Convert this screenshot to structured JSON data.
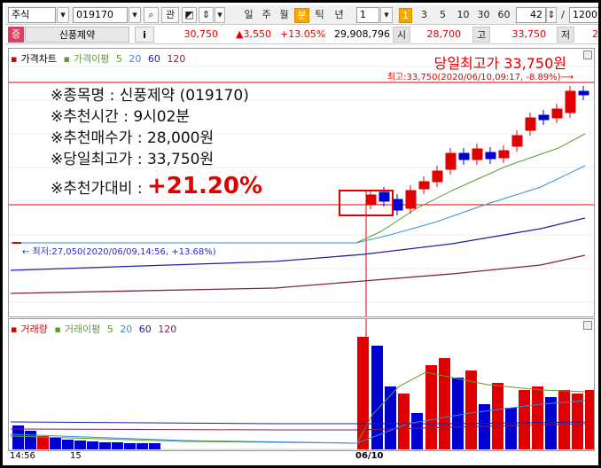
{
  "toolbar": {
    "market": "주식",
    "code": "019170",
    "btn_relation": "관",
    "periods": [
      {
        "label": "일",
        "active": false
      },
      {
        "label": "주",
        "active": false
      },
      {
        "label": "월",
        "active": false
      },
      {
        "label": "분",
        "active": true
      },
      {
        "label": "틱",
        "active": false
      },
      {
        "label": "년",
        "active": false
      }
    ],
    "interval_value": "1",
    "minute_buttons": [
      {
        "label": "1",
        "active": true
      },
      {
        "label": "3",
        "active": false
      },
      {
        "label": "5",
        "active": false
      },
      {
        "label": "10",
        "active": false
      },
      {
        "label": "30",
        "active": false
      },
      {
        "label": "60",
        "active": false
      }
    ],
    "count_value": "42",
    "count_total": "1200"
  },
  "quote": {
    "badge": "증",
    "name": "신풍제약",
    "info_btn": "i",
    "price": "30,750",
    "change": "▲3,550",
    "change_pct": "+13.05%",
    "volume": "29,908,796",
    "open_label": "시",
    "open": "28,700",
    "high_label": "고",
    "high": "33,750",
    "low_label": "저",
    "low_partial": "2"
  },
  "price_legend": {
    "title": "가격차트",
    "ma_label": "가격이평",
    "ma": [
      "5",
      "20",
      "60",
      "120"
    ]
  },
  "volume_legend": {
    "title": "거래량",
    "ma_label": "거래이평",
    "ma": [
      "5",
      "20",
      "60",
      "120"
    ]
  },
  "overlay": {
    "line1": "※종목명 : 신풍제약 (019170)",
    "line2": "※추천시간 : 9시02분",
    "line3": "※추천매수가 : 28,000원",
    "line4": "※당일최고가 : 33,750원",
    "line5_label": "※추천가대비 : ",
    "line5_value": "+21.20%"
  },
  "annotations": {
    "high_title": "당일최고가 33,750원",
    "high_note": "최고:33,750(2020/06/10,09:17, -8.89%)⟶",
    "low_note": "← 최저:27,050(2020/06/09,14:56, +13.68%)"
  },
  "xaxis": {
    "labels": [
      "14:56",
      "15",
      "06/10"
    ]
  },
  "colors": {
    "up": "#e00000",
    "down": "#0000d0",
    "ma5": "#5aa02c",
    "ma20": "#3a8fd8",
    "ma60": "#2020a0",
    "ma120": "#802050",
    "accent": "#f6a800"
  }
}
